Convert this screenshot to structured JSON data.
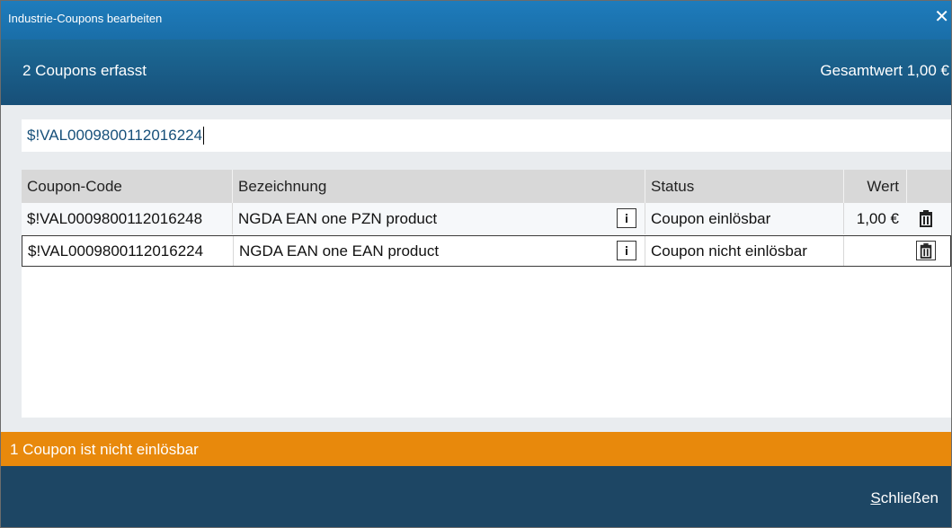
{
  "window": {
    "title": "Industrie-Coupons bearbeiten",
    "close_glyph": "✕"
  },
  "header": {
    "count_text": "2 Coupons erfasst",
    "total_text": "Gesamtwert 1,00 €"
  },
  "input": {
    "value": "$!VAL0009800112016224"
  },
  "table": {
    "columns": [
      "Coupon-Code",
      "Bezeichnung",
      "Status",
      "Wert"
    ],
    "rows": [
      {
        "code": "$!VAL0009800112016248",
        "name": "NGDA EAN one PZN product",
        "status": "Coupon einlösbar",
        "value": "1,00 €"
      },
      {
        "code": "$!VAL0009800112016224",
        "name": "NGDA EAN one EAN product",
        "status": "Coupon nicht einlösbar",
        "value": ""
      }
    ]
  },
  "status_bar": {
    "text": "1 Coupon ist nicht einlösbar",
    "color": "#e8890c"
  },
  "footer": {
    "close_label_mnemonic": "S",
    "close_label_rest": "chließen"
  },
  "icons": {
    "info": "info-icon",
    "delete": "trash-icon"
  }
}
